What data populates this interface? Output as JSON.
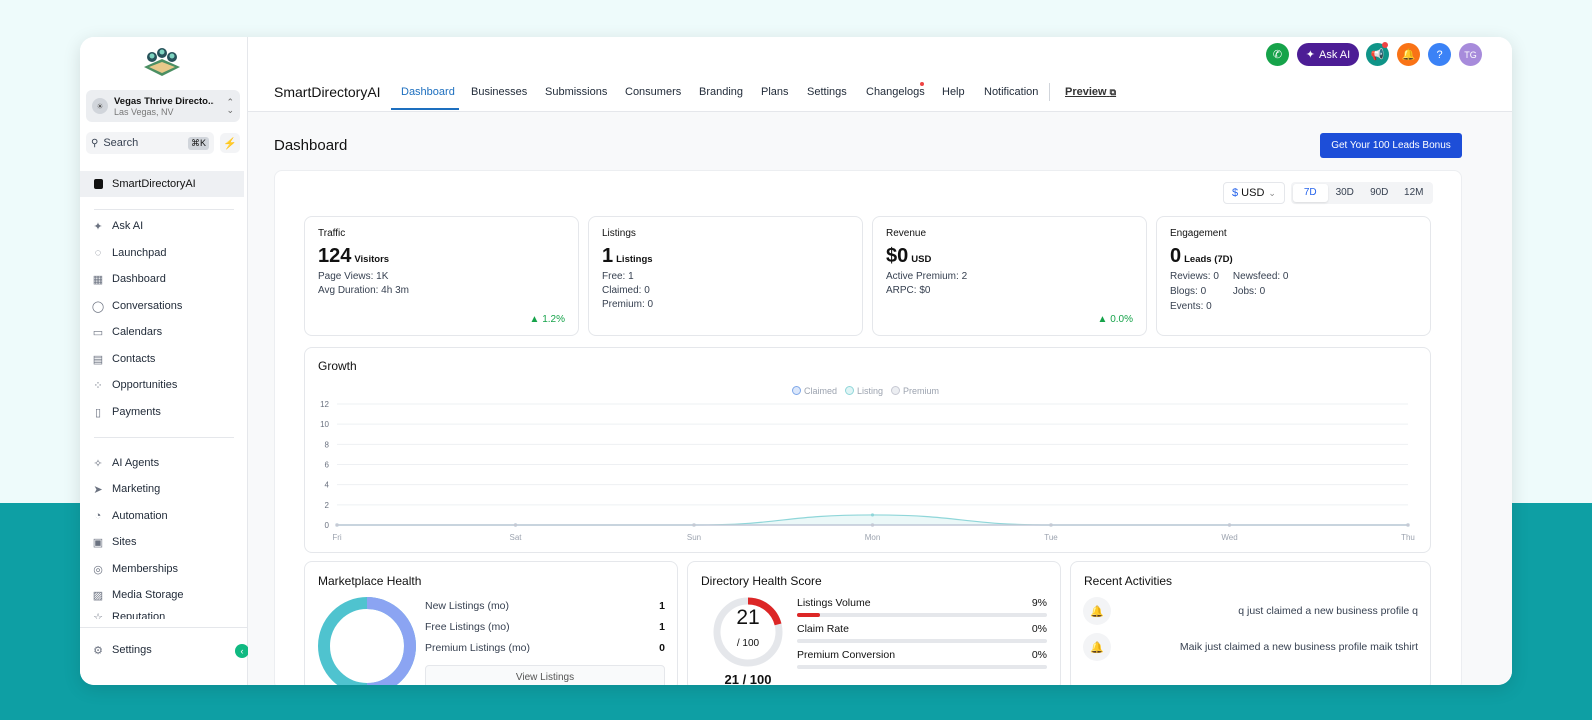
{
  "sidebar": {
    "location_name": "Vegas Thrive Directo...",
    "location_city": "Las Vegas, NV",
    "location_initial": "☀",
    "search_label": "Search",
    "search_shortcut": "⌘K",
    "agency_label": "SmartDirectoryAI",
    "items": [
      {
        "label": "Ask AI",
        "icon": "sparkle-icon"
      },
      {
        "label": "Launchpad",
        "icon": "rocket-icon"
      },
      {
        "label": "Dashboard",
        "icon": "grid-icon"
      },
      {
        "label": "Conversations",
        "icon": "chat-icon"
      },
      {
        "label": "Calendars",
        "icon": "calendar-icon"
      },
      {
        "label": "Contacts",
        "icon": "contacts-icon"
      },
      {
        "label": "Opportunities",
        "icon": "opportunities-icon"
      },
      {
        "label": "Payments",
        "icon": "payments-icon"
      }
    ],
    "items2": [
      {
        "label": "AI Agents",
        "icon": "ai-agents-icon"
      },
      {
        "label": "Marketing",
        "icon": "send-icon"
      },
      {
        "label": "Automation",
        "icon": "automation-icon"
      },
      {
        "label": "Sites",
        "icon": "sites-icon"
      },
      {
        "label": "Memberships",
        "icon": "badge-icon"
      },
      {
        "label": "Media Storage",
        "icon": "image-icon"
      },
      {
        "label": "Reputation",
        "icon": "star-icon"
      }
    ],
    "settings_label": "Settings"
  },
  "topbar": {
    "ask_ai_label": "Ask AI",
    "help_label": "?",
    "avatar_initials": "TG",
    "colors": {
      "phone": "#16a34a",
      "ask_ai": "#4c1d95",
      "megaphone": "#0f9488",
      "bell": "#f97316",
      "help": "#3b82f6",
      "avatar": "#a78bdb"
    }
  },
  "tabs": {
    "brand": "SmartDirectoryAI",
    "items": [
      "Dashboard",
      "Businesses",
      "Submissions",
      "Consumers",
      "Branding",
      "Plans",
      "Settings",
      "Changelogs",
      "Help",
      "Notification"
    ],
    "preview": "Preview"
  },
  "page": {
    "title": "Dashboard",
    "bonus_button": "Get Your 100 Leads Bonus"
  },
  "controls": {
    "currency_symbol": "$",
    "currency": "USD",
    "ranges": [
      "7D",
      "30D",
      "90D",
      "12M"
    ],
    "active_range": "7D"
  },
  "cards": {
    "traffic": {
      "label": "Traffic",
      "value": "124",
      "unit": "Visitors",
      "line1": "Page Views: 1K",
      "line2": "Avg Duration: 4h 3m",
      "trend": "▲ 1.2%"
    },
    "listings": {
      "label": "Listings",
      "value": "1",
      "unit": "Listings",
      "line1": "Free: 1",
      "line2": "Claimed: 0",
      "line3": "Premium: 0"
    },
    "revenue": {
      "label": "Revenue",
      "value": "$0",
      "unit": "USD",
      "line1": "Active Premium: 2",
      "line2": "ARPC: $0",
      "trend": "▲ 0.0%"
    },
    "engagement": {
      "label": "Engagement",
      "value": "0",
      "unit": "Leads (7D)",
      "reviews": "Reviews: 0",
      "blogs": "Blogs: 0",
      "events": "Events: 0",
      "newsfeed": "Newsfeed: 0",
      "jobs": "Jobs: 0"
    }
  },
  "growth": {
    "title": "Growth"
  },
  "chart_data": {
    "type": "area",
    "categories": [
      "Fri",
      "Sat",
      "Sun",
      "Mon",
      "Tue",
      "Wed",
      "Thu"
    ],
    "series": [
      {
        "name": "Claimed",
        "values": [
          0,
          0,
          0,
          0,
          0,
          0,
          0
        ],
        "color": "#7ea7e8"
      },
      {
        "name": "Listing",
        "values": [
          0,
          0,
          0,
          1,
          0,
          0,
          0
        ],
        "color": "#8fd6d9"
      },
      {
        "name": "Premium",
        "values": [
          0,
          0,
          0,
          0,
          0,
          0,
          0
        ],
        "color": "#c7c9d3"
      }
    ],
    "yticks": [
      0,
      2,
      4,
      6,
      8,
      10,
      12
    ],
    "ylim": [
      0,
      12
    ],
    "grid": true,
    "legend": "top-center"
  },
  "marketplace": {
    "title": "Marketplace Health",
    "rows": [
      {
        "label": "New Listings (mo)",
        "value": "1"
      },
      {
        "label": "Free Listings (mo)",
        "value": "1"
      },
      {
        "label": "Premium Listings (mo)",
        "value": "0"
      }
    ],
    "view_button": "View Listings"
  },
  "health": {
    "title": "Directory Health Score",
    "score": "21",
    "score_max": "/ 100",
    "score_fraction": 0.21,
    "footer": "21 / 100",
    "metrics": [
      {
        "label": "Listings Volume",
        "value": "9%",
        "fill": 0.09
      },
      {
        "label": "Claim Rate",
        "value": "0%",
        "fill": 0
      },
      {
        "label": "Premium Conversion",
        "value": "0%",
        "fill": 0
      }
    ]
  },
  "activities": {
    "title": "Recent Activities",
    "items": [
      "q just claimed a new business profile q",
      "Maik just claimed a new business profile maik tshirt"
    ]
  }
}
